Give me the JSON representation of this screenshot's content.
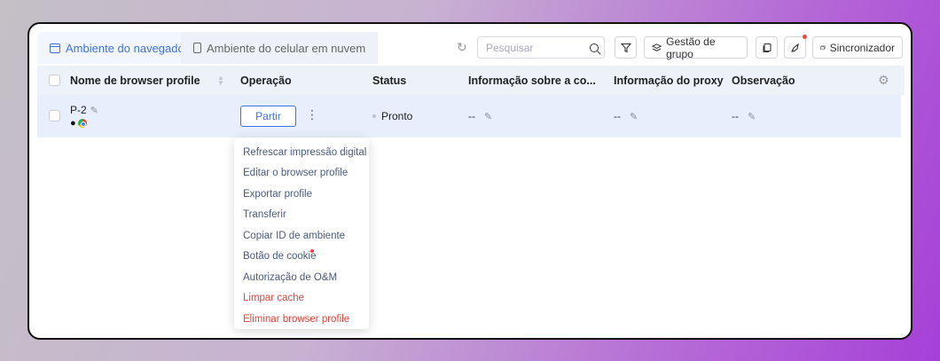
{
  "tabs": [
    {
      "label": "Ambiente do navegador",
      "icon": "browser-window-icon",
      "active": true
    },
    {
      "label": "Ambiente do celular em nuvem",
      "icon": "phone-icon",
      "active": false
    }
  ],
  "search": {
    "placeholder": "Pesquisar"
  },
  "toolbar": {
    "group_label": "Gestão de grupo",
    "sync_label": "Sincronizador"
  },
  "table": {
    "columns": [
      "Nome de browser profile",
      "Operação",
      "Status",
      "Informação sobre a co...",
      "Informação do proxy",
      "Observação"
    ],
    "rows": [
      {
        "name": "P-2",
        "os_icons": [
          "apple-icon",
          "chrome-icon"
        ],
        "action": "Partir",
        "status": "Pronto",
        "info": "--",
        "proxy": "--",
        "note": "--"
      }
    ]
  },
  "menu": {
    "items": [
      {
        "label": "Refrescar impressão digital",
        "danger": false
      },
      {
        "label": "Editar o browser profile",
        "danger": false
      },
      {
        "label": "Exportar profile",
        "danger": false
      },
      {
        "label": "Transferir",
        "danger": false
      },
      {
        "label": "Copiar ID de ambiente",
        "danger": false
      },
      {
        "label": "Botão de cookie",
        "danger": false,
        "badge": true
      },
      {
        "label": "Autorização de O&M",
        "danger": false
      },
      {
        "label": "Limpar cache",
        "danger": true
      },
      {
        "label": "Eliminar browser profile",
        "danger": true
      }
    ]
  },
  "colors": {
    "accent": "#3d72e6",
    "danger": "#e8413a",
    "row_selected": "#e6effb",
    "header_bg": "#edf1f8"
  }
}
